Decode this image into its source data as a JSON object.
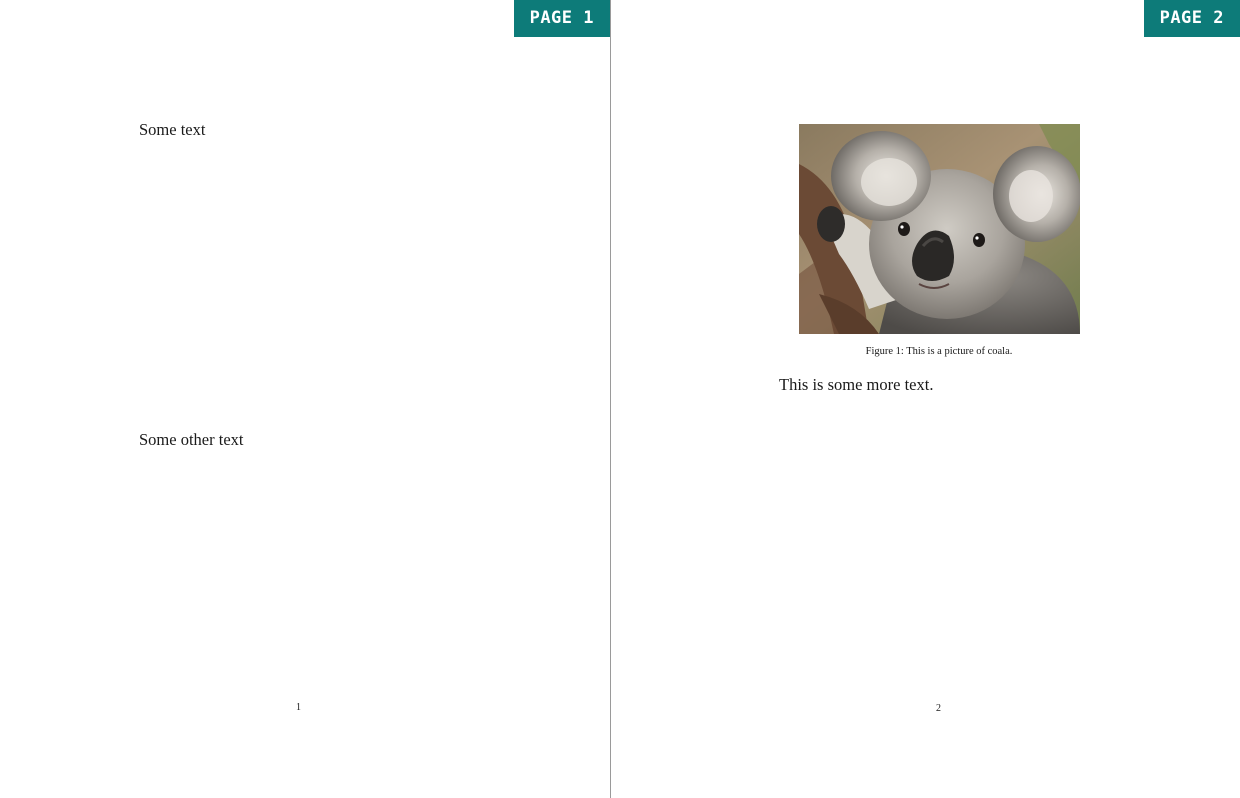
{
  "pages": [
    {
      "tag": "PAGE 1",
      "paragraphs": [
        "Some text",
        "Some other text"
      ],
      "page_number": "1"
    },
    {
      "tag": "PAGE 2",
      "figure": {
        "caption": "Figure 1: This is a picture of coala.",
        "image_subject": "koala-photo"
      },
      "paragraphs": [
        "This is some more text."
      ],
      "page_number": "2"
    }
  ],
  "colors": {
    "tag_background": "#0d7b79",
    "tag_text": "#ffffff",
    "divider": "#9a9a9a"
  }
}
